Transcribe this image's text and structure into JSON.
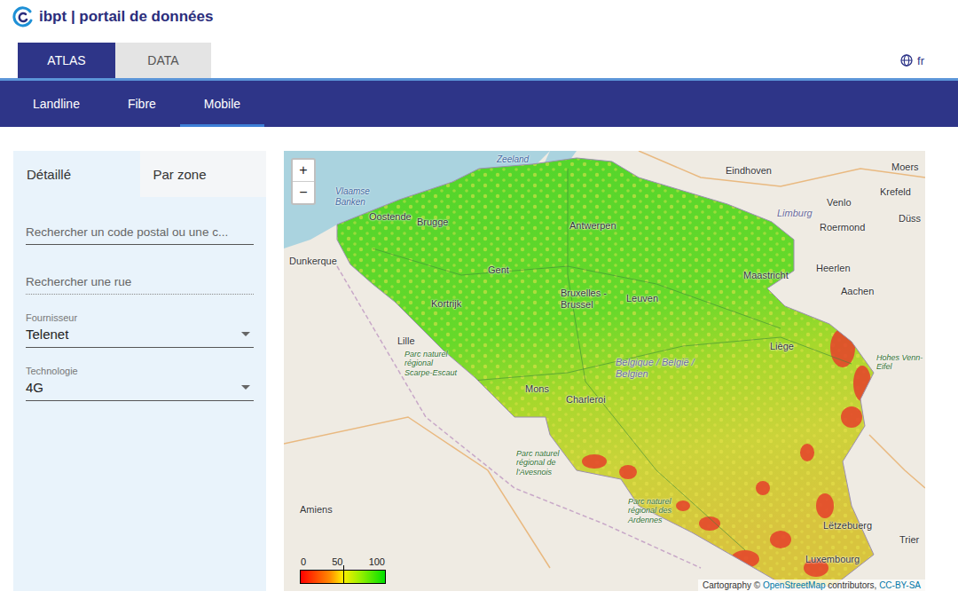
{
  "header": {
    "brand": "ibpt | portail de données"
  },
  "top_tabs": [
    {
      "label": "ATLAS",
      "selected": true
    },
    {
      "label": "DATA",
      "selected": false
    }
  ],
  "language": "fr",
  "nav": [
    {
      "label": "Landline",
      "selected": false
    },
    {
      "label": "Fibre",
      "selected": false
    },
    {
      "label": "Mobile",
      "selected": true
    }
  ],
  "panel": {
    "tabs": [
      {
        "label": "Détaillé",
        "selected": true
      },
      {
        "label": "Par zone",
        "selected": false
      }
    ],
    "search_postal": {
      "placeholder": "Rechercher un code postal ou une c..."
    },
    "search_street": {
      "placeholder": "Rechercher une rue"
    },
    "provider": {
      "label": "Fournisseur",
      "value": "Telenet"
    },
    "technology": {
      "label": "Technologie",
      "value": "4G"
    }
  },
  "map": {
    "zoom_in": "+",
    "zoom_out": "−",
    "labels": [
      {
        "text": "Zeeland",
        "kind": "water"
      },
      {
        "text": "Eindhoven",
        "kind": "city"
      },
      {
        "text": "Moers",
        "kind": "city"
      },
      {
        "text": "Krefeld",
        "kind": "city"
      },
      {
        "text": "Venlo",
        "kind": "city"
      },
      {
        "text": "Düss",
        "kind": "city"
      },
      {
        "text": "Vlaamse Banken",
        "kind": "water"
      },
      {
        "text": "Oostende",
        "kind": "city"
      },
      {
        "text": "Brugge",
        "kind": "city"
      },
      {
        "text": "Antwerpen",
        "kind": "city"
      },
      {
        "text": "Limburg",
        "kind": "region"
      },
      {
        "text": "Roermond",
        "kind": "city"
      },
      {
        "text": "Dunkerque",
        "kind": "city"
      },
      {
        "text": "Gent",
        "kind": "city"
      },
      {
        "text": "Maastricht",
        "kind": "city"
      },
      {
        "text": "Heerlen",
        "kind": "city"
      },
      {
        "text": "Aachen",
        "kind": "city"
      },
      {
        "text": "Bruxelles - Brussel",
        "kind": "city"
      },
      {
        "text": "Leuven",
        "kind": "city"
      },
      {
        "text": "Kortrijk",
        "kind": "city"
      },
      {
        "text": "Lille",
        "kind": "city"
      },
      {
        "text": "Parc naturel régional Scarpe-Escaut",
        "kind": "park"
      },
      {
        "text": "Liège",
        "kind": "city"
      },
      {
        "text": "Belgique / België / Belgien",
        "kind": "region"
      },
      {
        "text": "Hohes Venn-Eifel",
        "kind": "park"
      },
      {
        "text": "Mons",
        "kind": "city"
      },
      {
        "text": "Charleroi",
        "kind": "city"
      },
      {
        "text": "Parc naturel régional de l'Avesnois",
        "kind": "park"
      },
      {
        "text": "Parc naturel régional des Ardennes",
        "kind": "park"
      },
      {
        "text": "Amiens",
        "kind": "city"
      },
      {
        "text": "Lëtzebuerg",
        "kind": "city"
      },
      {
        "text": "Trier",
        "kind": "city"
      },
      {
        "text": "Luxembourg",
        "kind": "city"
      }
    ],
    "legend": {
      "ticks": [
        "0",
        "50",
        "100"
      ]
    },
    "attribution": [
      {
        "text": "Cartography © ",
        "link": false
      },
      {
        "text": "OpenStreetMap",
        "link": true
      },
      {
        "text": " contributors, ",
        "link": false
      },
      {
        "text": "CC-BY-SA",
        "link": true
      }
    ]
  }
}
